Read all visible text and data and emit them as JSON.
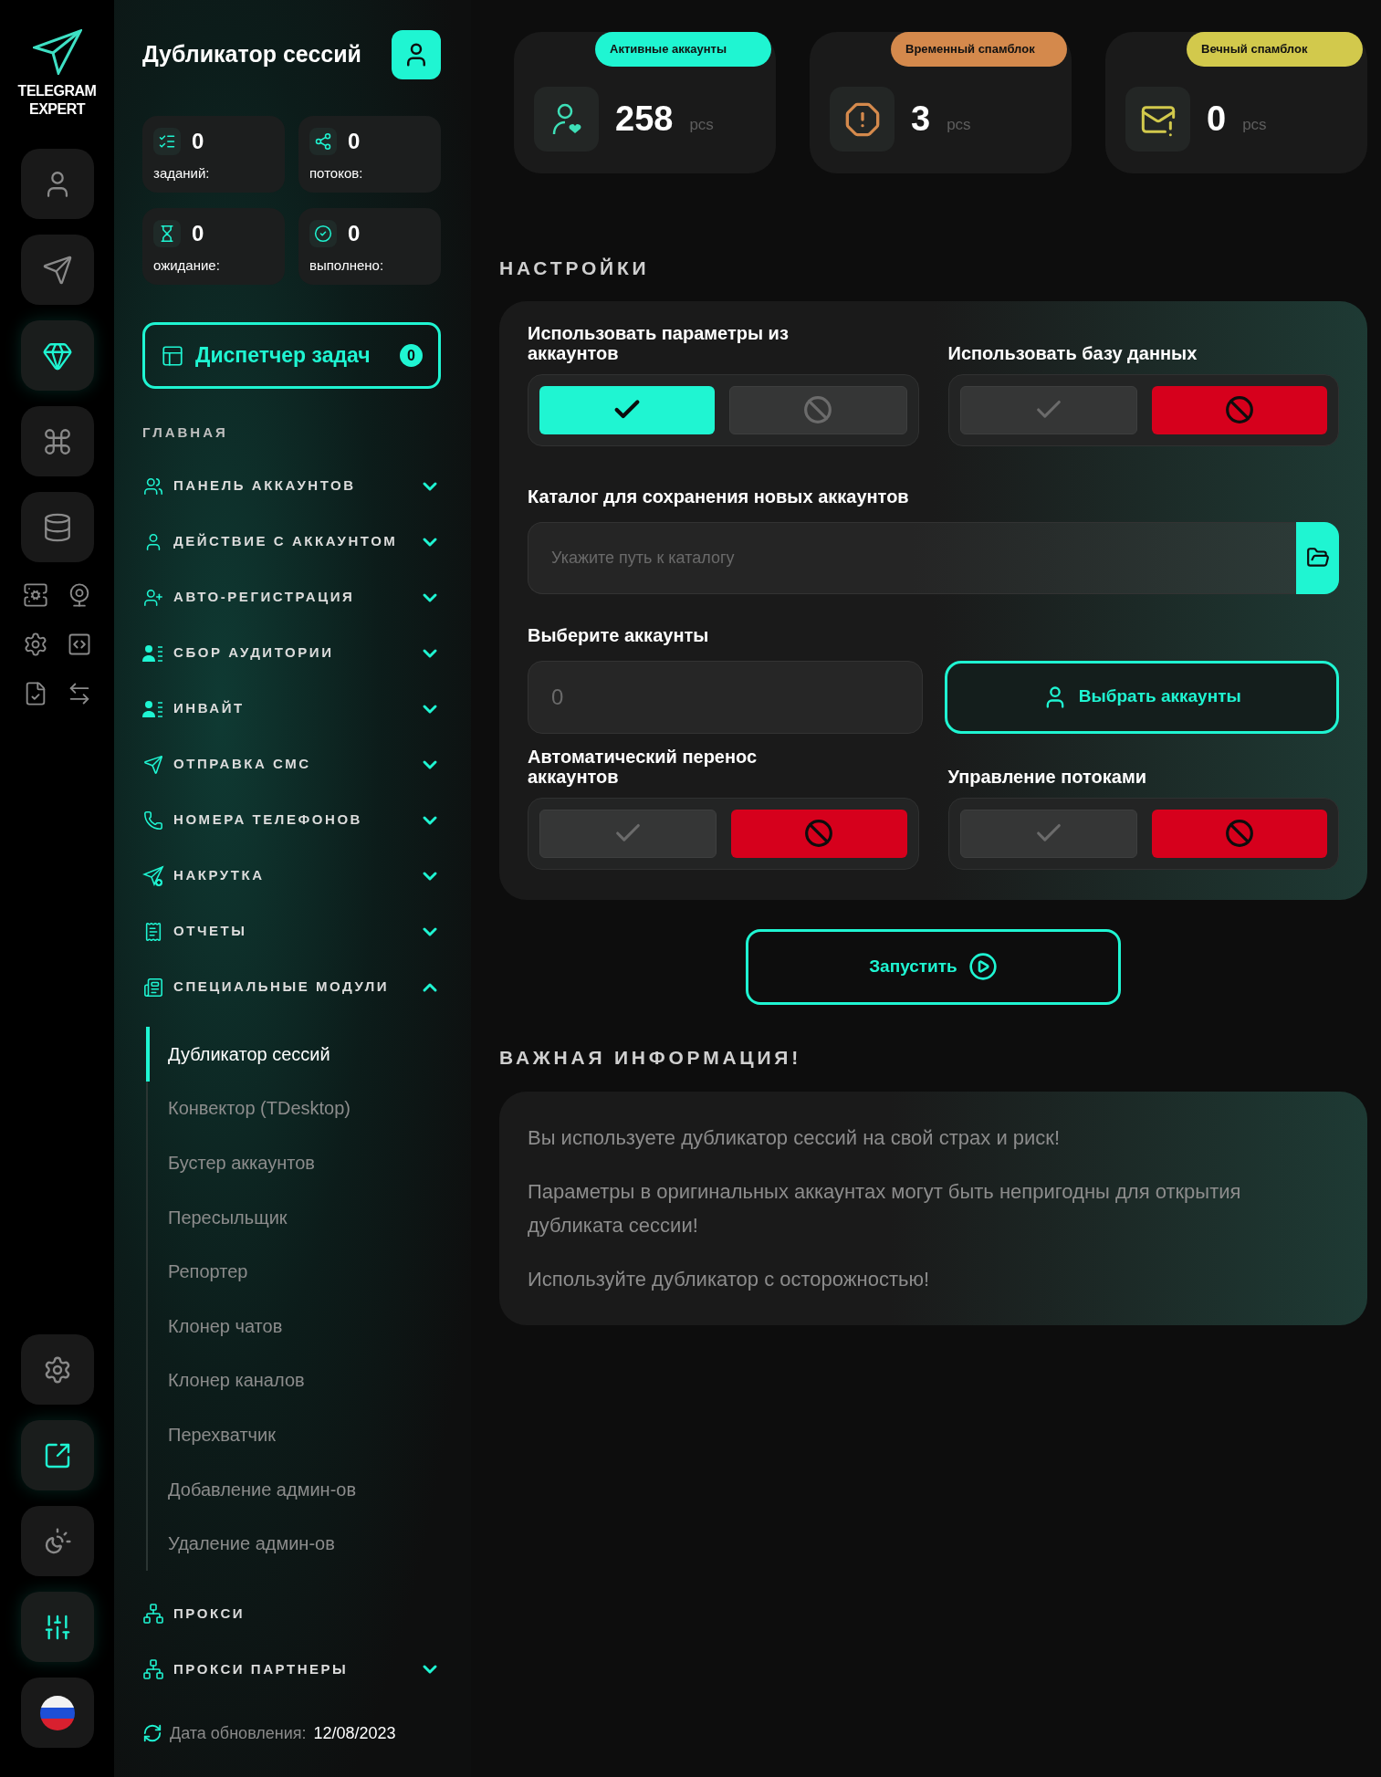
{
  "brand": {
    "line1": "TELEGRAM",
    "line2": "EXPERT"
  },
  "rail": {
    "top": [
      {
        "highlighted": false
      },
      {
        "highlighted": false
      },
      {
        "highlighted": true
      },
      {
        "highlighted": false
      },
      {
        "highlighted": false
      }
    ],
    "bottom": [
      {
        "highlighted": false
      },
      {
        "highlighted": true
      },
      {
        "highlighted": false
      },
      {
        "highlighted": true
      },
      {
        "kind": "flag",
        "highlighted": false
      }
    ]
  },
  "sidebar": {
    "title": "Дубликатор сессий",
    "stats": [
      {
        "value": "0",
        "label": "заданий:"
      },
      {
        "value": "0",
        "label": "потоков:"
      },
      {
        "value": "0",
        "label": "ожидание:"
      },
      {
        "value": "0",
        "label": "выполнено:"
      }
    ],
    "dispatcher": {
      "label": "Диспетчер задач",
      "badge": "0"
    },
    "section": "ГЛАВНАЯ",
    "items": [
      {
        "label": "ПАНЕЛЬ АККАУНТОВ",
        "expanded": false
      },
      {
        "label": "ДЕЙСТВИЕ С АККАУНТОМ",
        "expanded": false
      },
      {
        "label": "АВТО-РЕГИСТРАЦИЯ",
        "expanded": false
      },
      {
        "label": "СБОР АУДИТОРИИ",
        "expanded": false
      },
      {
        "label": "ИНВАЙТ",
        "expanded": false
      },
      {
        "label": "ОТПРАВКА СМС",
        "expanded": false
      },
      {
        "label": "НОМЕРА ТЕЛЕФОНОВ",
        "expanded": false
      },
      {
        "label": "НАКРУТКА",
        "expanded": false
      },
      {
        "label": "ОТЧЕТЫ",
        "expanded": false
      },
      {
        "label": "СПЕЦИАЛЬНЫЕ МОДУЛИ",
        "expanded": true,
        "children": [
          {
            "label": "Дубликатор сессий",
            "selected": true
          },
          {
            "label": "Конвектор (TDesktop)",
            "selected": false
          },
          {
            "label": "Бустер аккаунтов",
            "selected": false
          },
          {
            "label": "Пересыльщик",
            "selected": false
          },
          {
            "label": "Репортер",
            "selected": false
          },
          {
            "label": "Клонер чатов",
            "selected": false
          },
          {
            "label": "Клонер каналов",
            "selected": false
          },
          {
            "label": "Перехватчик",
            "selected": false
          },
          {
            "label": "Добавление админ-ов",
            "selected": false
          },
          {
            "label": "Удаление админ-ов",
            "selected": false
          }
        ]
      }
    ],
    "extra_items": [
      {
        "label": "ПРОКСИ",
        "expandable": false
      },
      {
        "label": "ПРОКСИ ПАРТНЕРЫ",
        "expandable": true
      }
    ],
    "update": {
      "label": "Дата обновления:",
      "date": "12/08/2023"
    }
  },
  "stat_cards": [
    {
      "label": "Активные аккаунты",
      "value": "258",
      "unit": "pcs",
      "color": "#1ff5d2"
    },
    {
      "label": "Временный спамблок",
      "value": "3",
      "unit": "pcs",
      "color": "#d4894c"
    },
    {
      "label": "Вечный спамблок",
      "value": "0",
      "unit": "pcs",
      "color": "#d2c94c"
    }
  ],
  "settings": {
    "heading": "НАСТРОЙКИ",
    "toggles_top": [
      {
        "label": "Использовать параметры из аккаунтов",
        "on": true
      },
      {
        "label": "Использовать базу данных",
        "on": false
      }
    ],
    "catalog": {
      "label": "Каталог для сохранения новых аккаунтов",
      "placeholder": "Укажите путь к каталогу"
    },
    "accounts": {
      "label": "Выберите аккаунты",
      "placeholder": "0",
      "button": "Выбрать аккаунты"
    },
    "toggles_bottom": [
      {
        "label": "Автоматический перенос аккаунтов",
        "on": false
      },
      {
        "label": "Управление потоками",
        "on": false
      }
    ]
  },
  "launch_button": "Запустить",
  "info": {
    "heading": "ВАЖНАЯ ИНФОРМАЦИЯ!",
    "paragraphs": [
      "Вы используете дубликатор сессий на свой страх и риск!",
      "Параметры в оригинальных аккаунтах могут быть непригодны для открытия дубликата сессии!",
      "Используйте дубликатор с осторожностью!"
    ]
  }
}
